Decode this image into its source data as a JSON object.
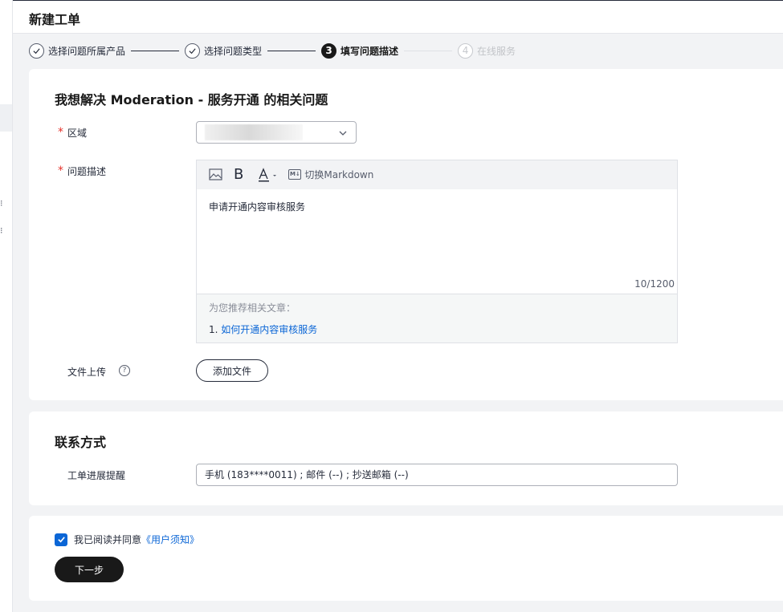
{
  "header": {
    "title": "新建工单"
  },
  "steps": [
    {
      "label": "选择问题所属产品",
      "state": "done"
    },
    {
      "label": "选择问题类型",
      "state": "done"
    },
    {
      "label": "填写问题描述",
      "state": "active",
      "number": "3"
    },
    {
      "label": "在线服务",
      "state": "todo",
      "number": "4"
    }
  ],
  "problem": {
    "title": "我想解决 Moderation - 服务开通 的相关问题",
    "region_label": "区域",
    "description_label": "问题描述",
    "editor": {
      "bold_label": "B",
      "markdown_toggle": "切换Markdown",
      "content": "申请开通内容审核服务",
      "counter": "10/1200"
    },
    "recommend": {
      "title": "为您推荐相关文章：",
      "index": "1.",
      "link": "如何开通内容审核服务"
    },
    "upload_label": "文件上传",
    "upload_button": "添加文件"
  },
  "contact": {
    "title": "联系方式",
    "reminder_label": "工单进展提醒",
    "reminder_value": "手机 (183****0011) ; 邮件 (--) ; 抄送邮箱 (--)"
  },
  "agreement": {
    "text": "我已阅读并同意",
    "link": "《用户须知》",
    "checked": true
  },
  "next_button": "下一步",
  "colors": {
    "accent": "#0b66d6",
    "dark": "#191919",
    "required": "#e5332c"
  }
}
